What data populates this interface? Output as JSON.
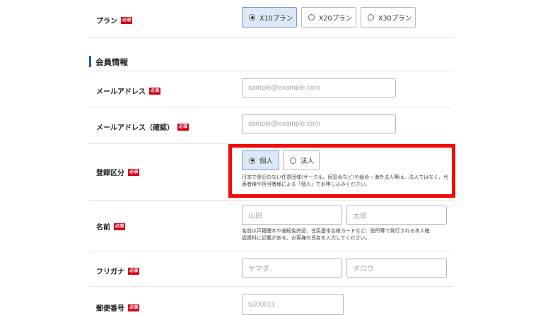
{
  "plan": {
    "label": "プラン",
    "required": "必須",
    "options": [
      {
        "label": "X10プラン",
        "selected": true
      },
      {
        "label": "X20プラン",
        "selected": false
      },
      {
        "label": "X30プラン",
        "selected": false
      }
    ]
  },
  "section": {
    "title": "会員情報"
  },
  "email": {
    "label": "メールアドレス",
    "required": "必須",
    "placeholder": "sample@example.com"
  },
  "email_confirm": {
    "label": "メールアドレス（確認）",
    "required": "必須",
    "placeholder": "sample@example.com"
  },
  "registration": {
    "label": "登録区分",
    "required": "必須",
    "options": [
      {
        "label": "個人",
        "selected": true
      },
      {
        "label": "法人",
        "selected": false
      }
    ],
    "note_line1": "日本で登記のない任意団体(サークル、同窓会など)や組合・海外法人等は、法人ではなく、代表者様や担当者様による「個人」でお申し込みください。",
    "note_line2": "く、代表者様や担当者様による「個人」でお申し込みください。"
  },
  "name": {
    "label": "名前",
    "required": "必須",
    "last_placeholder": "山田",
    "first_placeholder": "太郎",
    "note_line1": "名前は戸籍謄本や運転免許証、住民基本台帳カードなど、役所等で発行される本人確",
    "note_line2": "認資料に記載がある、お客様の氏名を入力してください。"
  },
  "furigana": {
    "label": "フリガナ",
    "required": "必須",
    "last_placeholder": "ヤマダ",
    "first_placeholder": "タロウ"
  },
  "postal": {
    "label": "郵便番号",
    "required": "必須",
    "placeholder": "5300011"
  },
  "colors": {
    "required_bg": "#d0021b",
    "selected_bg": "#dde8f6",
    "section_bar": "#1f5fb5",
    "highlight": "#f00a0a"
  }
}
